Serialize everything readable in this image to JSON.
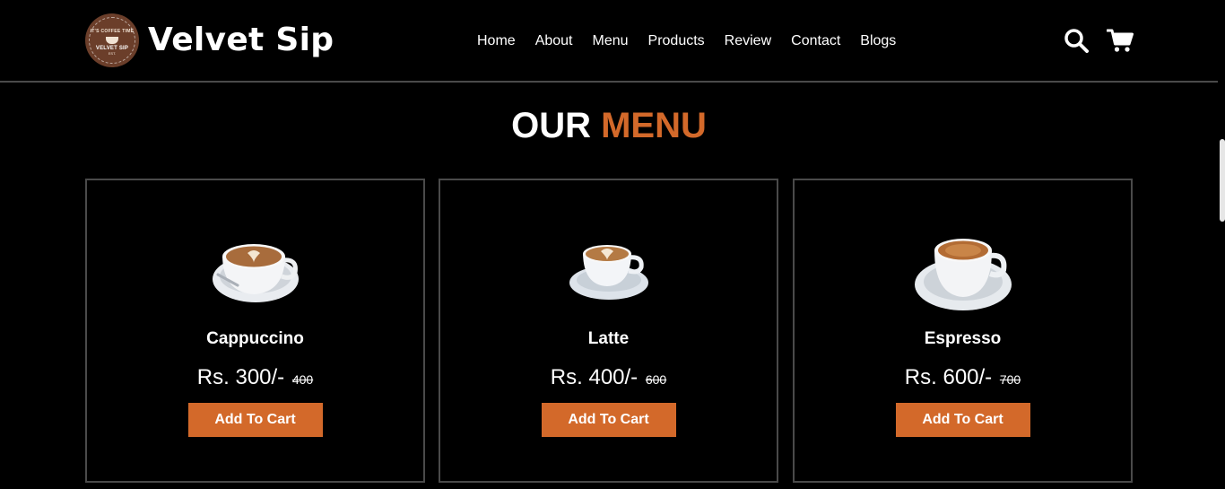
{
  "brand": {
    "name": "Velvet Sip",
    "logo_top_text": "IT'S COFFEE TIME",
    "logo_text": "VELVET SIP",
    "logo_est": "EST."
  },
  "nav": {
    "items": [
      {
        "label": "Home"
      },
      {
        "label": "About"
      },
      {
        "label": "Menu"
      },
      {
        "label": "Products"
      },
      {
        "label": "Review"
      },
      {
        "label": "Contact"
      },
      {
        "label": "Blogs"
      }
    ]
  },
  "header_icons": {
    "search": "search-icon",
    "cart": "cart-icon"
  },
  "section": {
    "title_part1": "OUR",
    "title_part2": "MENU"
  },
  "menu": [
    {
      "name": "Cappuccino",
      "price": "Rs. 300/-",
      "old_price": "400",
      "button": "Add To Cart"
    },
    {
      "name": "Latte",
      "price": "Rs. 400/-",
      "old_price": "600",
      "button": "Add To Cart"
    },
    {
      "name": "Espresso",
      "price": "Rs. 600/-",
      "old_price": "700",
      "button": "Add To Cart"
    }
  ],
  "colors": {
    "accent": "#d3692a",
    "background": "#000000",
    "border": "#4a4a4a",
    "logo_brown": "#6b3e2a"
  }
}
